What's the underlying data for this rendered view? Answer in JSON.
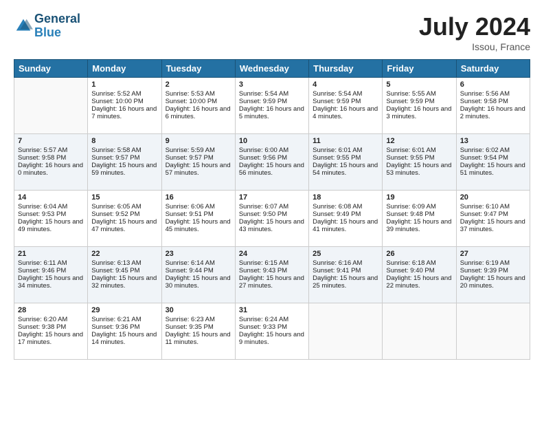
{
  "logo": {
    "line1": "General",
    "line2": "Blue"
  },
  "title": {
    "month_year": "July 2024",
    "location": "Issou, France"
  },
  "days_of_week": [
    "Sunday",
    "Monday",
    "Tuesday",
    "Wednesday",
    "Thursday",
    "Friday",
    "Saturday"
  ],
  "weeks": [
    [
      {
        "day": "",
        "sunrise": "",
        "sunset": "",
        "daylight": ""
      },
      {
        "day": "1",
        "sunrise": "Sunrise: 5:52 AM",
        "sunset": "Sunset: 10:00 PM",
        "daylight": "Daylight: 16 hours and 7 minutes."
      },
      {
        "day": "2",
        "sunrise": "Sunrise: 5:53 AM",
        "sunset": "Sunset: 10:00 PM",
        "daylight": "Daylight: 16 hours and 6 minutes."
      },
      {
        "day": "3",
        "sunrise": "Sunrise: 5:54 AM",
        "sunset": "Sunset: 9:59 PM",
        "daylight": "Daylight: 16 hours and 5 minutes."
      },
      {
        "day": "4",
        "sunrise": "Sunrise: 5:54 AM",
        "sunset": "Sunset: 9:59 PM",
        "daylight": "Daylight: 16 hours and 4 minutes."
      },
      {
        "day": "5",
        "sunrise": "Sunrise: 5:55 AM",
        "sunset": "Sunset: 9:59 PM",
        "daylight": "Daylight: 16 hours and 3 minutes."
      },
      {
        "day": "6",
        "sunrise": "Sunrise: 5:56 AM",
        "sunset": "Sunset: 9:58 PM",
        "daylight": "Daylight: 16 hours and 2 minutes."
      }
    ],
    [
      {
        "day": "7",
        "sunrise": "Sunrise: 5:57 AM",
        "sunset": "Sunset: 9:58 PM",
        "daylight": "Daylight: 16 hours and 0 minutes."
      },
      {
        "day": "8",
        "sunrise": "Sunrise: 5:58 AM",
        "sunset": "Sunset: 9:57 PM",
        "daylight": "Daylight: 15 hours and 59 minutes."
      },
      {
        "day": "9",
        "sunrise": "Sunrise: 5:59 AM",
        "sunset": "Sunset: 9:57 PM",
        "daylight": "Daylight: 15 hours and 57 minutes."
      },
      {
        "day": "10",
        "sunrise": "Sunrise: 6:00 AM",
        "sunset": "Sunset: 9:56 PM",
        "daylight": "Daylight: 15 hours and 56 minutes."
      },
      {
        "day": "11",
        "sunrise": "Sunrise: 6:01 AM",
        "sunset": "Sunset: 9:55 PM",
        "daylight": "Daylight: 15 hours and 54 minutes."
      },
      {
        "day": "12",
        "sunrise": "Sunrise: 6:01 AM",
        "sunset": "Sunset: 9:55 PM",
        "daylight": "Daylight: 15 hours and 53 minutes."
      },
      {
        "day": "13",
        "sunrise": "Sunrise: 6:02 AM",
        "sunset": "Sunset: 9:54 PM",
        "daylight": "Daylight: 15 hours and 51 minutes."
      }
    ],
    [
      {
        "day": "14",
        "sunrise": "Sunrise: 6:04 AM",
        "sunset": "Sunset: 9:53 PM",
        "daylight": "Daylight: 15 hours and 49 minutes."
      },
      {
        "day": "15",
        "sunrise": "Sunrise: 6:05 AM",
        "sunset": "Sunset: 9:52 PM",
        "daylight": "Daylight: 15 hours and 47 minutes."
      },
      {
        "day": "16",
        "sunrise": "Sunrise: 6:06 AM",
        "sunset": "Sunset: 9:51 PM",
        "daylight": "Daylight: 15 hours and 45 minutes."
      },
      {
        "day": "17",
        "sunrise": "Sunrise: 6:07 AM",
        "sunset": "Sunset: 9:50 PM",
        "daylight": "Daylight: 15 hours and 43 minutes."
      },
      {
        "day": "18",
        "sunrise": "Sunrise: 6:08 AM",
        "sunset": "Sunset: 9:49 PM",
        "daylight": "Daylight: 15 hours and 41 minutes."
      },
      {
        "day": "19",
        "sunrise": "Sunrise: 6:09 AM",
        "sunset": "Sunset: 9:48 PM",
        "daylight": "Daylight: 15 hours and 39 minutes."
      },
      {
        "day": "20",
        "sunrise": "Sunrise: 6:10 AM",
        "sunset": "Sunset: 9:47 PM",
        "daylight": "Daylight: 15 hours and 37 minutes."
      }
    ],
    [
      {
        "day": "21",
        "sunrise": "Sunrise: 6:11 AM",
        "sunset": "Sunset: 9:46 PM",
        "daylight": "Daylight: 15 hours and 34 minutes."
      },
      {
        "day": "22",
        "sunrise": "Sunrise: 6:13 AM",
        "sunset": "Sunset: 9:45 PM",
        "daylight": "Daylight: 15 hours and 32 minutes."
      },
      {
        "day": "23",
        "sunrise": "Sunrise: 6:14 AM",
        "sunset": "Sunset: 9:44 PM",
        "daylight": "Daylight: 15 hours and 30 minutes."
      },
      {
        "day": "24",
        "sunrise": "Sunrise: 6:15 AM",
        "sunset": "Sunset: 9:43 PM",
        "daylight": "Daylight: 15 hours and 27 minutes."
      },
      {
        "day": "25",
        "sunrise": "Sunrise: 6:16 AM",
        "sunset": "Sunset: 9:41 PM",
        "daylight": "Daylight: 15 hours and 25 minutes."
      },
      {
        "day": "26",
        "sunrise": "Sunrise: 6:18 AM",
        "sunset": "Sunset: 9:40 PM",
        "daylight": "Daylight: 15 hours and 22 minutes."
      },
      {
        "day": "27",
        "sunrise": "Sunrise: 6:19 AM",
        "sunset": "Sunset: 9:39 PM",
        "daylight": "Daylight: 15 hours and 20 minutes."
      }
    ],
    [
      {
        "day": "28",
        "sunrise": "Sunrise: 6:20 AM",
        "sunset": "Sunset: 9:38 PM",
        "daylight": "Daylight: 15 hours and 17 minutes."
      },
      {
        "day": "29",
        "sunrise": "Sunrise: 6:21 AM",
        "sunset": "Sunset: 9:36 PM",
        "daylight": "Daylight: 15 hours and 14 minutes."
      },
      {
        "day": "30",
        "sunrise": "Sunrise: 6:23 AM",
        "sunset": "Sunset: 9:35 PM",
        "daylight": "Daylight: 15 hours and 11 minutes."
      },
      {
        "day": "31",
        "sunrise": "Sunrise: 6:24 AM",
        "sunset": "Sunset: 9:33 PM",
        "daylight": "Daylight: 15 hours and 9 minutes."
      },
      {
        "day": "",
        "sunrise": "",
        "sunset": "",
        "daylight": ""
      },
      {
        "day": "",
        "sunrise": "",
        "sunset": "",
        "daylight": ""
      },
      {
        "day": "",
        "sunrise": "",
        "sunset": "",
        "daylight": ""
      }
    ]
  ]
}
